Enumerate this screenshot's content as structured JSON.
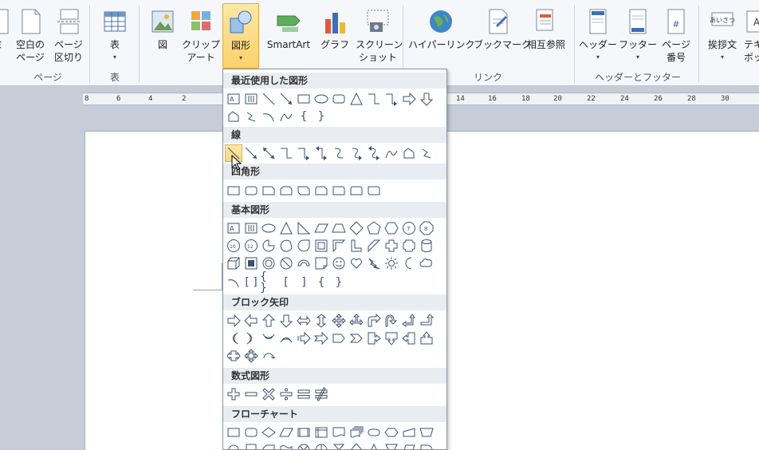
{
  "ribbon": {
    "groups": [
      {
        "name": "pages",
        "label": "ページ"
      },
      {
        "name": "table",
        "label": "表"
      },
      {
        "name": "illustrations",
        "label": ""
      },
      {
        "name": "links",
        "label": "リンク"
      },
      {
        "name": "header-footer",
        "label": "ヘッダーとフッター"
      }
    ],
    "buttons": {
      "cover_fragment": "ミ",
      "blank_page": [
        "空白の",
        "ページ"
      ],
      "page_break": [
        "ページ",
        "区切り"
      ],
      "table": "表",
      "picture": "図",
      "clipart": [
        "クリップ",
        "アート"
      ],
      "shapes": "図形",
      "smartart": "SmartArt",
      "chart": "グラフ",
      "screenshot": [
        "スクリーン",
        "ショット"
      ],
      "hyperlink": "ハイパーリンク",
      "bookmark": "ブックマーク",
      "crossref": "相互参照",
      "header": "ヘッダー",
      "footer": "フッター",
      "page_number": [
        "ページ",
        "番号"
      ],
      "greeting": "挨拶文",
      "textbox_fragment": [
        "テキ",
        "ボッ"
      ]
    }
  },
  "ruler": {
    "ticks": [
      "8",
      "6",
      "4",
      "2",
      "14",
      "16",
      "18",
      "20",
      "22",
      "24",
      "26",
      "28",
      "30"
    ]
  },
  "shapes_panel": {
    "sections": [
      {
        "title": "最近使用した図形"
      },
      {
        "title": "線"
      },
      {
        "title": "四角形"
      },
      {
        "title": "基本図形"
      },
      {
        "title": "ブロック矢印"
      },
      {
        "title": "数式図形"
      },
      {
        "title": "フローチャート"
      }
    ]
  },
  "colors": {
    "accent": "#fcd26a",
    "shape_stroke": "#3b5370",
    "ribbon_bg": "#f5f7fb"
  }
}
